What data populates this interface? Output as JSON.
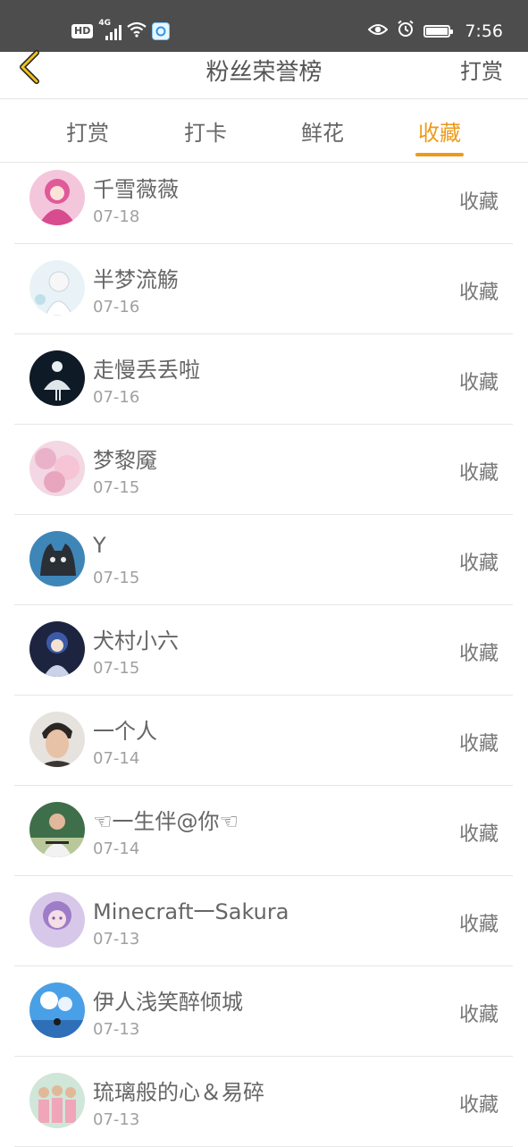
{
  "status_bar": {
    "hd": "HD",
    "network": "4G",
    "time": "7:56"
  },
  "header": {
    "title": "粉丝荣誉榜",
    "right_action": "打赏",
    "accent_color": "#ee9a1a"
  },
  "tabs": [
    {
      "label": "打赏",
      "active": false
    },
    {
      "label": "打卡",
      "active": false
    },
    {
      "label": "鲜花",
      "active": false
    },
    {
      "label": "收藏",
      "active": true
    }
  ],
  "fans": [
    {
      "name": "千雪薇薇",
      "date": "07-18",
      "action": "收藏"
    },
    {
      "name": "半梦流觞",
      "date": "07-16",
      "action": "收藏"
    },
    {
      "name": "走慢丢丢啦",
      "date": "07-16",
      "action": "收藏"
    },
    {
      "name": "梦黎魇",
      "date": "07-15",
      "action": "收藏"
    },
    {
      "name": "Y",
      "date": "07-15",
      "action": "收藏"
    },
    {
      "name": "犬村小六",
      "date": "07-15",
      "action": "收藏"
    },
    {
      "name": "一个人",
      "date": "07-14",
      "action": "收藏"
    },
    {
      "name": "☜一生伴@你☜",
      "date": "07-14",
      "action": "收藏"
    },
    {
      "name": "Minecraft一Sakura",
      "date": "07-13",
      "action": "收藏"
    },
    {
      "name": "伊人浅笑醉倾城",
      "date": "07-13",
      "action": "收藏"
    },
    {
      "name": "琉璃般的心＆易碎",
      "date": "07-13",
      "action": "收藏"
    }
  ]
}
